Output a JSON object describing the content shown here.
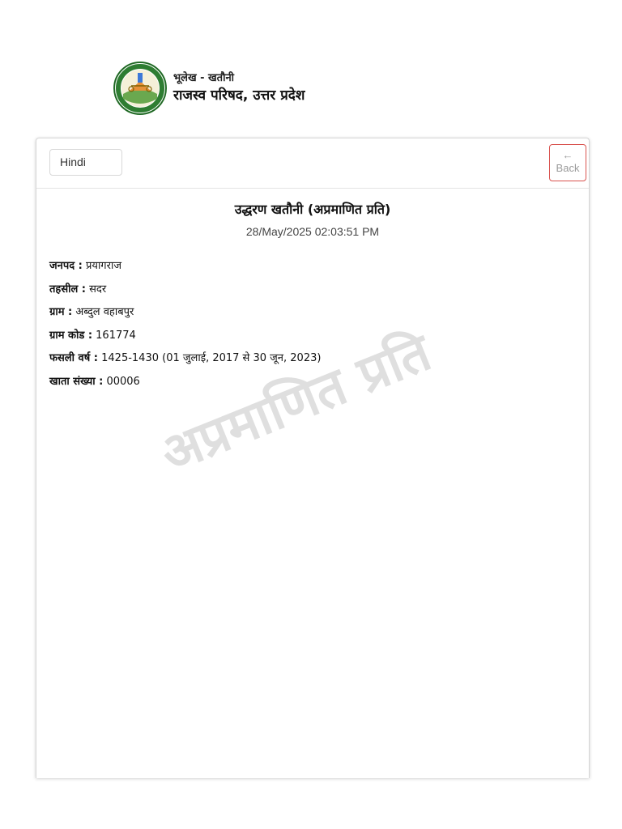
{
  "header": {
    "logo_icon": "up-revenue-board-seal-icon",
    "subtitle": "भूलेख - खतौनी",
    "title": "राजस्व परिषद, उत्तर प्रदेश"
  },
  "toolbar": {
    "language_selected": "Hindi",
    "back_arrow": "←",
    "back_label": "Back",
    "back_border_color": "#d9534f"
  },
  "document": {
    "title": "उद्धरण खतौनी (अप्रमाणित प्रति)",
    "timestamp": "28/May/2025 02:03:51 PM",
    "fields": [
      {
        "label": "जनपद :",
        "value": " प्रयागराज"
      },
      {
        "label": "तहसील :",
        "value": " सदर"
      },
      {
        "label": "ग्राम :",
        "value": " अब्दुल वहाबपुर"
      },
      {
        "label": "ग्राम कोड :",
        "value": " 161774"
      },
      {
        "label": "फसली वर्ष :",
        "value": " 1425-1430 (01 जुलाई, 2017 से 30 जून, 2023)"
      },
      {
        "label": "खाता संख्या :",
        "value": " 00006"
      }
    ],
    "watermark": "अप्रमाणित प्रति"
  }
}
